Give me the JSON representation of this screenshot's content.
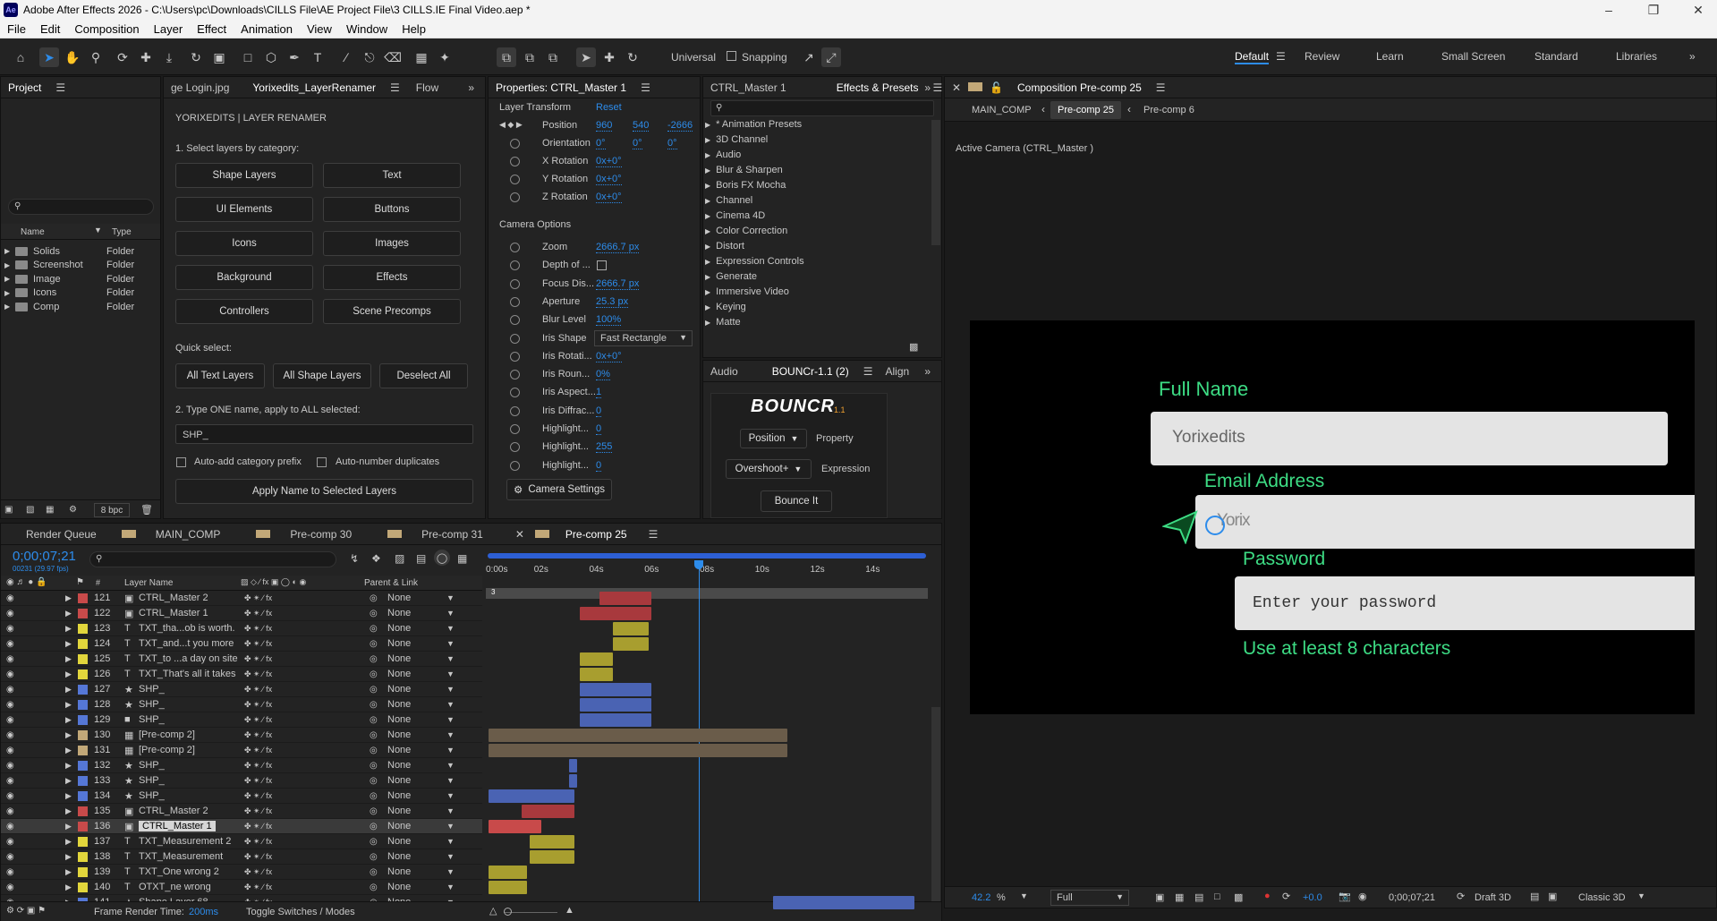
{
  "titlebar": {
    "app_icon": "Ae",
    "title": "Adobe After Effects 2026 - C:\\Users\\pc\\Downloads\\CILLS File\\AE Project File\\3 CILLS.IE Final Video.aep *"
  },
  "menu": [
    "File",
    "Edit",
    "Composition",
    "Layer",
    "Effect",
    "Animation",
    "View",
    "Window",
    "Help"
  ],
  "toolbar": {
    "universal_label": "Universal",
    "snapping_label": "Snapping"
  },
  "workspaces": [
    "Default",
    "Review",
    "Learn",
    "Small Screen",
    "Standard",
    "Libraries"
  ],
  "project": {
    "tab": "Project",
    "col_name": "Name",
    "col_type": "Type",
    "items": [
      {
        "name": "Solids",
        "type": "Folder"
      },
      {
        "name": "Screenshot",
        "type": "Folder"
      },
      {
        "name": "Image",
        "type": "Folder"
      },
      {
        "name": "Icons",
        "type": "Folder"
      },
      {
        "name": "Comp",
        "type": "Folder"
      }
    ],
    "bpc": "8 bpc"
  },
  "renamer": {
    "tabs": [
      "ge Login.jpg",
      "Yorixedits_LayerRenamer",
      "Flow"
    ],
    "heading": "YORIXEDITS  |  LAYER RENAMER",
    "step1": "1. Select layers by category:",
    "categories": [
      "Shape Layers",
      "Text",
      "UI Elements",
      "Buttons",
      "Icons",
      "Images",
      "Background",
      "Effects",
      "Controllers",
      "Scene Precomps"
    ],
    "quick_label": "Quick select:",
    "quick": [
      "All Text Layers",
      "All Shape Layers",
      "Deselect All"
    ],
    "step2": "2. Type ONE name, apply to ALL selected:",
    "name_value": "SHP_",
    "opt1": "Auto-add category prefix",
    "opt2": "Auto-number duplicates",
    "apply": "Apply Name to Selected Layers"
  },
  "properties": {
    "tab": "Properties: CTRL_Master 1",
    "layer_transform": "Layer Transform",
    "reset": "Reset",
    "position_label": "Position",
    "position": [
      "960",
      "540",
      "-2666"
    ],
    "orientation_label": "Orientation",
    "orientation": [
      "0°",
      "0°",
      "0°"
    ],
    "xrot_label": "X Rotation",
    "xrot": "0x+0°",
    "yrot_label": "Y Rotation",
    "yrot": "0x+0°",
    "zrot_label": "Z Rotation",
    "zrot": "0x+0°",
    "camera_options": "Camera Options",
    "rows": [
      {
        "label": "Zoom",
        "value": "2666.7 px"
      },
      {
        "label": "Depth of ...",
        "value": ""
      },
      {
        "label": "Focus Dis...",
        "value": "2666.7 px"
      },
      {
        "label": "Aperture",
        "value": "25.3 px"
      },
      {
        "label": "Blur Level",
        "value": "100%"
      },
      {
        "label": "Iris Shape",
        "value": "Fast Rectangle"
      },
      {
        "label": "Iris Rotati...",
        "value": "0x+0°"
      },
      {
        "label": "Iris Roun...",
        "value": "0%"
      },
      {
        "label": "Iris Aspect...",
        "value": "1"
      },
      {
        "label": "Iris Diffrac...",
        "value": "0"
      },
      {
        "label": "Highlight...",
        "value": "0"
      },
      {
        "label": "Highlight...",
        "value": "255"
      },
      {
        "label": "Highlight...",
        "value": "0"
      }
    ],
    "camera_settings": "Camera Settings"
  },
  "effects": {
    "tab1": "CTRL_Master 1",
    "tab2": "Effects & Presets",
    "items": [
      "* Animation Presets",
      "3D Channel",
      "Audio",
      "Blur & Sharpen",
      "Boris FX Mocha",
      "Channel",
      "Cinema 4D",
      "Color Correction",
      "Distort",
      "Expression Controls",
      "Generate",
      "Immersive Video",
      "Keying",
      "Matte"
    ]
  },
  "bouncr": {
    "tabs": [
      "Audio",
      "BOUNCr-1.1 (2)",
      "Align"
    ],
    "logo": "BOUNCR",
    "logo_ver": "1.1",
    "position": "Position",
    "property": "Property",
    "overshoot": "Overshoot+",
    "expression": "Expression",
    "bounce": "Bounce It"
  },
  "composition": {
    "panel_title": "Composition Pre-comp 25",
    "breadcrumbs": [
      "MAIN_COMP",
      "Pre-comp 25",
      "Pre-comp 6"
    ],
    "active_camera": "Active Camera (CTRL_Master )",
    "canvas": {
      "full_name_label": "Full Name",
      "full_name_value": "Yorixedits",
      "email_label": "Email Address",
      "email_value": "Yorix",
      "password_label": "Password",
      "password_placeholder": "Enter your password",
      "hint": "Use at least 8 characters",
      "accent": "#3ddc84"
    },
    "footer": {
      "zoom": "42.2",
      "zoom_unit": "%",
      "resolution": "Full",
      "exposure": "+0.0",
      "timecode": "0;00;07;21",
      "renderer": "Draft 3D",
      "view": "Classic 3D"
    }
  },
  "timeline": {
    "tabs": [
      "Render Queue",
      "MAIN_COMP",
      "Pre-comp 30",
      "Pre-comp 31",
      "Pre-comp 25"
    ],
    "timecode": "0;00;07;21",
    "frames": "00231 (29.97 fps)",
    "col_layer_name": "Layer Name",
    "col_parent": "Parent & Link",
    "ruler": [
      "0:00s",
      "02s",
      "04s",
      "06s",
      "08s",
      "10s",
      "12s",
      "14s"
    ],
    "playhead_seconds": 7.7,
    "duration_seconds": 16,
    "layers": [
      {
        "num": "121",
        "name": "CTRL_Master 2",
        "type": "cam",
        "label": "#c84a4a",
        "parent": "None",
        "bar": [
          4.1,
          6.0
        ],
        "barc": "#a8393d"
      },
      {
        "num": "122",
        "name": "CTRL_Master 1",
        "type": "cam",
        "label": "#c84a4a",
        "parent": "None",
        "bar": [
          3.4,
          6.0
        ],
        "barc": "#a8393d"
      },
      {
        "num": "123",
        "name": "TXT_tha...ob is worth.",
        "type": "T",
        "label": "#e2d63c",
        "parent": "None",
        "bar": [
          4.6,
          5.9
        ],
        "barc": "#a89e2f"
      },
      {
        "num": "124",
        "name": "TXT_and...t you more",
        "type": "T",
        "label": "#e2d63c",
        "parent": "None",
        "bar": [
          4.6,
          5.9
        ],
        "barc": "#a89e2f"
      },
      {
        "num": "125",
        "name": "TXT_to ...a day on site",
        "type": "T",
        "label": "#e2d63c",
        "parent": "None",
        "bar": [
          3.4,
          4.6
        ],
        "barc": "#a89e2f"
      },
      {
        "num": "126",
        "name": "TXT_That's all it takes",
        "type": "T",
        "label": "#e2d63c",
        "parent": "None",
        "bar": [
          3.4,
          4.6
        ],
        "barc": "#a89e2f"
      },
      {
        "num": "127",
        "name": "SHP_",
        "type": "star",
        "label": "#5577d6",
        "parent": "None",
        "bar": [
          3.4,
          6.0
        ],
        "barc": "#4a63b3"
      },
      {
        "num": "128",
        "name": "SHP_",
        "type": "star",
        "label": "#5577d6",
        "parent": "None",
        "bar": [
          3.4,
          6.0
        ],
        "barc": "#4a63b3"
      },
      {
        "num": "129",
        "name": "SHP_",
        "type": "solid",
        "label": "#5577d6",
        "parent": "None",
        "bar": [
          3.4,
          6.0
        ],
        "barc": "#4a63b3"
      },
      {
        "num": "130",
        "name": "[Pre-comp 2]",
        "type": "comp",
        "label": "#c2a878",
        "parent": "None",
        "bar": [
          0.1,
          10.9
        ],
        "barc": "#6a5c4a"
      },
      {
        "num": "131",
        "name": "[Pre-comp 2]",
        "type": "comp",
        "label": "#c2a878",
        "parent": "None",
        "bar": [
          0.1,
          10.9
        ],
        "barc": "#6a5c4a"
      },
      {
        "num": "132",
        "name": "SHP_",
        "type": "star",
        "label": "#5577d6",
        "parent": "None",
        "bar": [
          3.0,
          3.3
        ],
        "barc": "#4a63b3"
      },
      {
        "num": "133",
        "name": "SHP_",
        "type": "star",
        "label": "#5577d6",
        "parent": "None",
        "bar": [
          3.0,
          3.3
        ],
        "barc": "#4a63b3"
      },
      {
        "num": "134",
        "name": "SHP_",
        "type": "star",
        "label": "#5577d6",
        "parent": "None",
        "bar": [
          0.1,
          3.2
        ],
        "barc": "#4a63b3"
      },
      {
        "num": "135",
        "name": "CTRL_Master 2",
        "type": "cam",
        "label": "#c84a4a",
        "parent": "None",
        "bar": [
          1.3,
          3.2
        ],
        "barc": "#a8393d"
      },
      {
        "num": "136",
        "name": "CTRL_Master 1",
        "type": "cam",
        "label": "#c84a4a",
        "parent": "None",
        "bar": [
          0.1,
          2.0
        ],
        "barc": "#c84a4a",
        "selected": true
      },
      {
        "num": "137",
        "name": "TXT_Measurement 2",
        "type": "T",
        "label": "#e2d63c",
        "parent": "None",
        "bar": [
          1.6,
          3.2
        ],
        "barc": "#a89e2f"
      },
      {
        "num": "138",
        "name": "TXT_Measurement",
        "type": "T",
        "label": "#e2d63c",
        "parent": "None",
        "bar": [
          1.6,
          3.2
        ],
        "barc": "#a89e2f"
      },
      {
        "num": "139",
        "name": "TXT_One wrong 2",
        "type": "T",
        "label": "#e2d63c",
        "parent": "None",
        "bar": [
          0.1,
          1.5
        ],
        "barc": "#a89e2f"
      },
      {
        "num": "140",
        "name": "OTXT_ne wrong",
        "type": "T",
        "label": "#e2d63c",
        "parent": "None",
        "bar": [
          0.1,
          1.5
        ],
        "barc": "#a89e2f"
      },
      {
        "num": "141",
        "name": "Shape Layer 68",
        "type": "star",
        "label": "#5577d6",
        "parent": "None",
        "bar": [
          10.4,
          15.5
        ],
        "barc": "#4a63b3"
      }
    ],
    "footer": {
      "render_time_label": "Frame Render Time:",
      "render_time": "200ms",
      "toggle": "Toggle Switches / Modes"
    }
  }
}
